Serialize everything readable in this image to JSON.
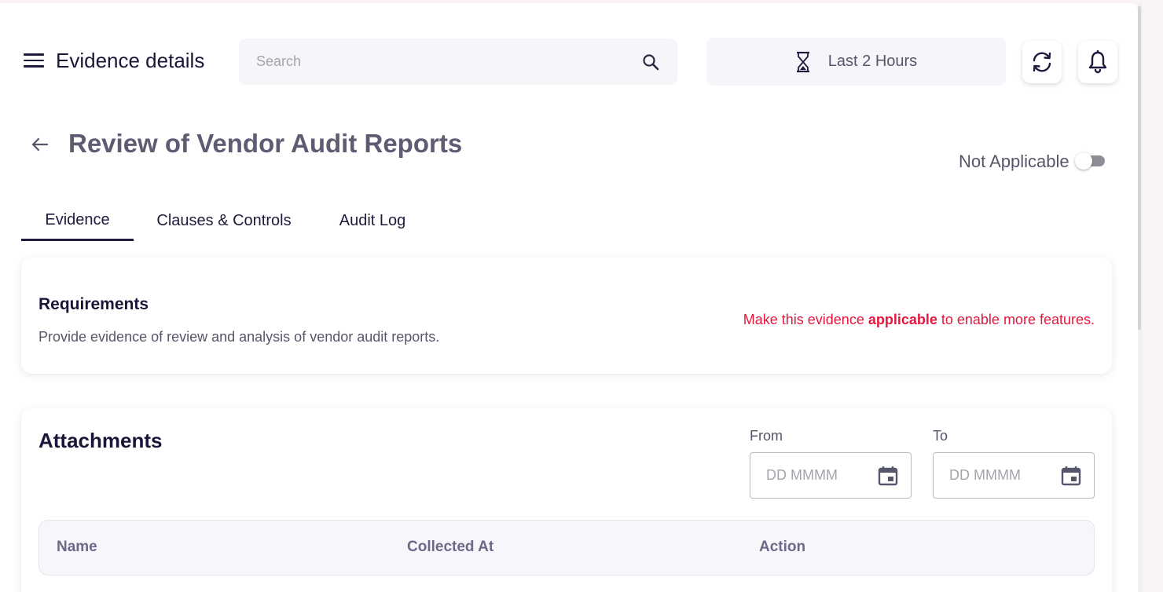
{
  "header": {
    "title": "Evidence details",
    "search_placeholder": "Search",
    "time_range": "Last 2 Hours"
  },
  "page": {
    "title": "Review of Vendor Audit Reports",
    "not_applicable_label": "Not Applicable",
    "not_applicable_on": false
  },
  "tabs": [
    {
      "label": "Evidence",
      "active": true
    },
    {
      "label": "Clauses & Controls",
      "active": false
    },
    {
      "label": "Audit Log",
      "active": false
    }
  ],
  "requirements": {
    "title": "Requirements",
    "description": "Provide evidence of review and analysis of vendor audit reports.",
    "note_prefix": "Make this evidence ",
    "note_bold": "applicable",
    "note_suffix": " to enable more features."
  },
  "attachments": {
    "title": "Attachments",
    "from_label": "From",
    "to_label": "To",
    "from_placeholder": "DD MMMM",
    "to_placeholder": "DD MMMM",
    "columns": [
      "Name",
      "Collected At",
      "Action"
    ]
  },
  "icons": {
    "menu": "hamburger-menu-icon",
    "search": "search-icon",
    "time": "hourglass-icon",
    "refresh": "refresh-icon",
    "notifications": "bell-icon",
    "back": "arrow-left-icon",
    "calendar": "calendar-icon"
  },
  "colors": {
    "primary_text": "#1a163a",
    "muted_text": "#55566a",
    "warning_text": "#e5173f",
    "field_bg": "#f6f6fa",
    "table_header_bg": "#f7f7fb"
  }
}
